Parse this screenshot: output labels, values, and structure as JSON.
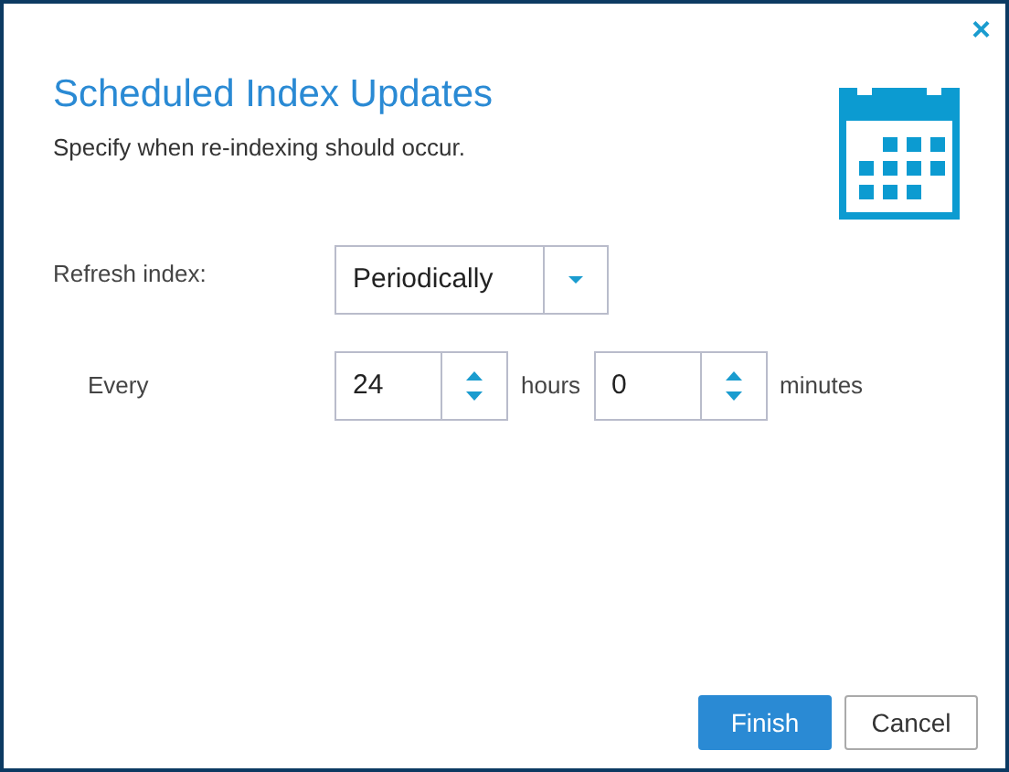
{
  "dialog": {
    "close": "×",
    "title": "Scheduled Index Updates",
    "subtitle": "Specify when re-indexing should occur."
  },
  "refresh": {
    "label": "Refresh index:",
    "value": "Periodically"
  },
  "every": {
    "label": "Every",
    "hours": {
      "value": "24",
      "unit": "hours"
    },
    "minutes": {
      "value": "0",
      "unit": "minutes"
    }
  },
  "buttons": [
    {
      "label": "Finish",
      "kind": "primary"
    },
    {
      "label": "Cancel",
      "kind": "secondary"
    }
  ]
}
